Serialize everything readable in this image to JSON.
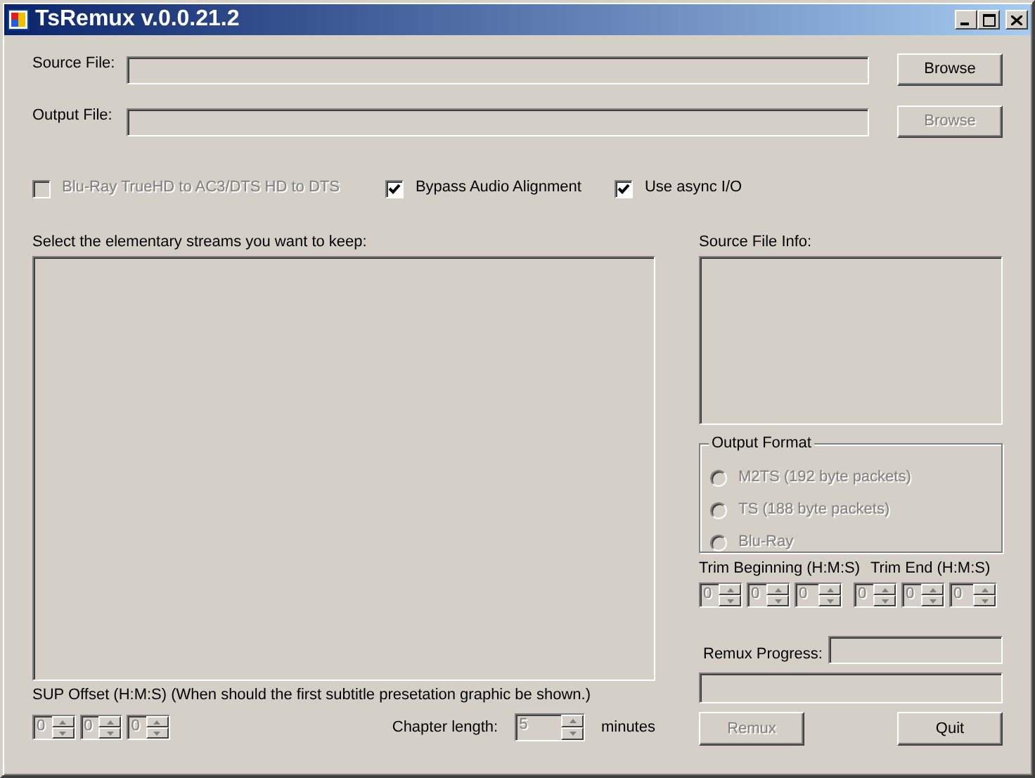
{
  "window": {
    "title": "TsRemux v.0.0.21.2"
  },
  "files": [
    {
      "label": "Source File:",
      "button": "Browse",
      "disabled": false
    },
    {
      "label": "Output File:",
      "button": "Browse",
      "disabled": true
    }
  ],
  "options": [
    {
      "label": "Blu-Ray TrueHD to AC3/DTS HD to DTS",
      "checked": false,
      "disabled": true
    },
    {
      "label": "Bypass Audio Alignment",
      "checked": true,
      "disabled": false
    },
    {
      "label": "Use async I/O",
      "checked": true,
      "disabled": false
    }
  ],
  "streams": {
    "label": "Select the elementary streams you want to keep:"
  },
  "source_info": {
    "label": "Source File Info:"
  },
  "output_format": {
    "title": "Output Format",
    "options": [
      {
        "label": "M2TS (192 byte packets)",
        "selected": false,
        "disabled": true
      },
      {
        "label": "TS (188 byte packets)",
        "selected": false,
        "disabled": true
      },
      {
        "label": "Blu-Ray",
        "selected": false,
        "disabled": true
      }
    ]
  },
  "trim": {
    "begin_label": "Trim Beginning (H:M:S)",
    "end_label": "Trim End (H:M:S)",
    "begin": [
      "0",
      "0",
      "0"
    ],
    "end": [
      "0",
      "0",
      "0"
    ],
    "disabled": true
  },
  "progress": {
    "label": "Remux Progress:",
    "level": 0
  },
  "buttons": [
    {
      "label": "Remux",
      "disabled": true
    },
    {
      "label": "Quit",
      "disabled": false
    }
  ],
  "sup_offset": {
    "label": "SUP Offset (H:M:S) (When should the first subtitle presetation graphic be shown.)",
    "values": [
      "0",
      "0",
      "0"
    ],
    "disabled": true
  },
  "chapter": {
    "label": "Chapter length:",
    "value": "5",
    "unit": "minutes",
    "disabled": true
  }
}
